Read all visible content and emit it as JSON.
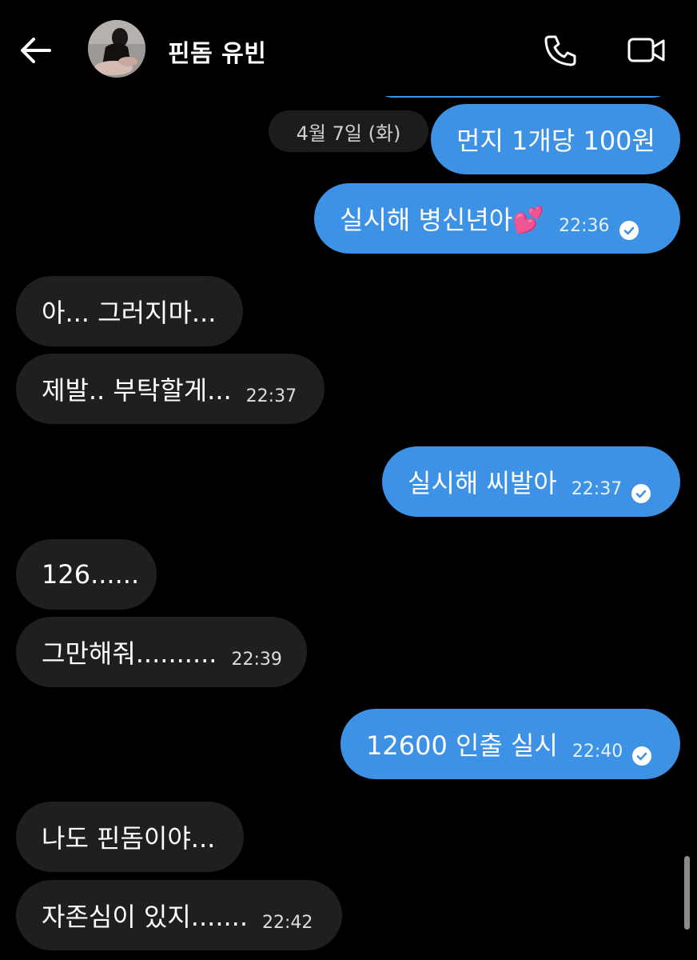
{
  "header": {
    "contact_name": "핀돔 유빈",
    "icons": {
      "back": "arrow-left-icon",
      "phone": "phone-icon",
      "video": "video-camera-icon"
    }
  },
  "date_separator": "4월 7일 (화)",
  "messages": [
    {
      "dir": "out",
      "text": "먼지 1개당 100원",
      "time": ""
    },
    {
      "dir": "out",
      "text": "실시해 병신년아💕",
      "time": "22:36",
      "read": true
    },
    {
      "dir": "in",
      "text": "아... 그러지마...",
      "time": ""
    },
    {
      "dir": "in",
      "text": "제발.. 부탁할게...",
      "time": "22:37"
    },
    {
      "dir": "out",
      "text": "실시해 씨발아",
      "time": "22:37",
      "read": true
    },
    {
      "dir": "in",
      "text": "126......",
      "time": ""
    },
    {
      "dir": "in",
      "text": "그만해줘..........",
      "time": "22:39"
    },
    {
      "dir": "out",
      "text": "12600 인출 실시",
      "time": "22:40",
      "read": true
    },
    {
      "dir": "in",
      "text": "나도 핀돔이야...",
      "time": ""
    },
    {
      "dir": "in",
      "text": "자존심이 있지.......",
      "time": "22:42"
    }
  ],
  "colors": {
    "outgoing_bubble": "#3d92e6",
    "incoming_bubble": "#1f1f1f",
    "background": "#000000"
  }
}
